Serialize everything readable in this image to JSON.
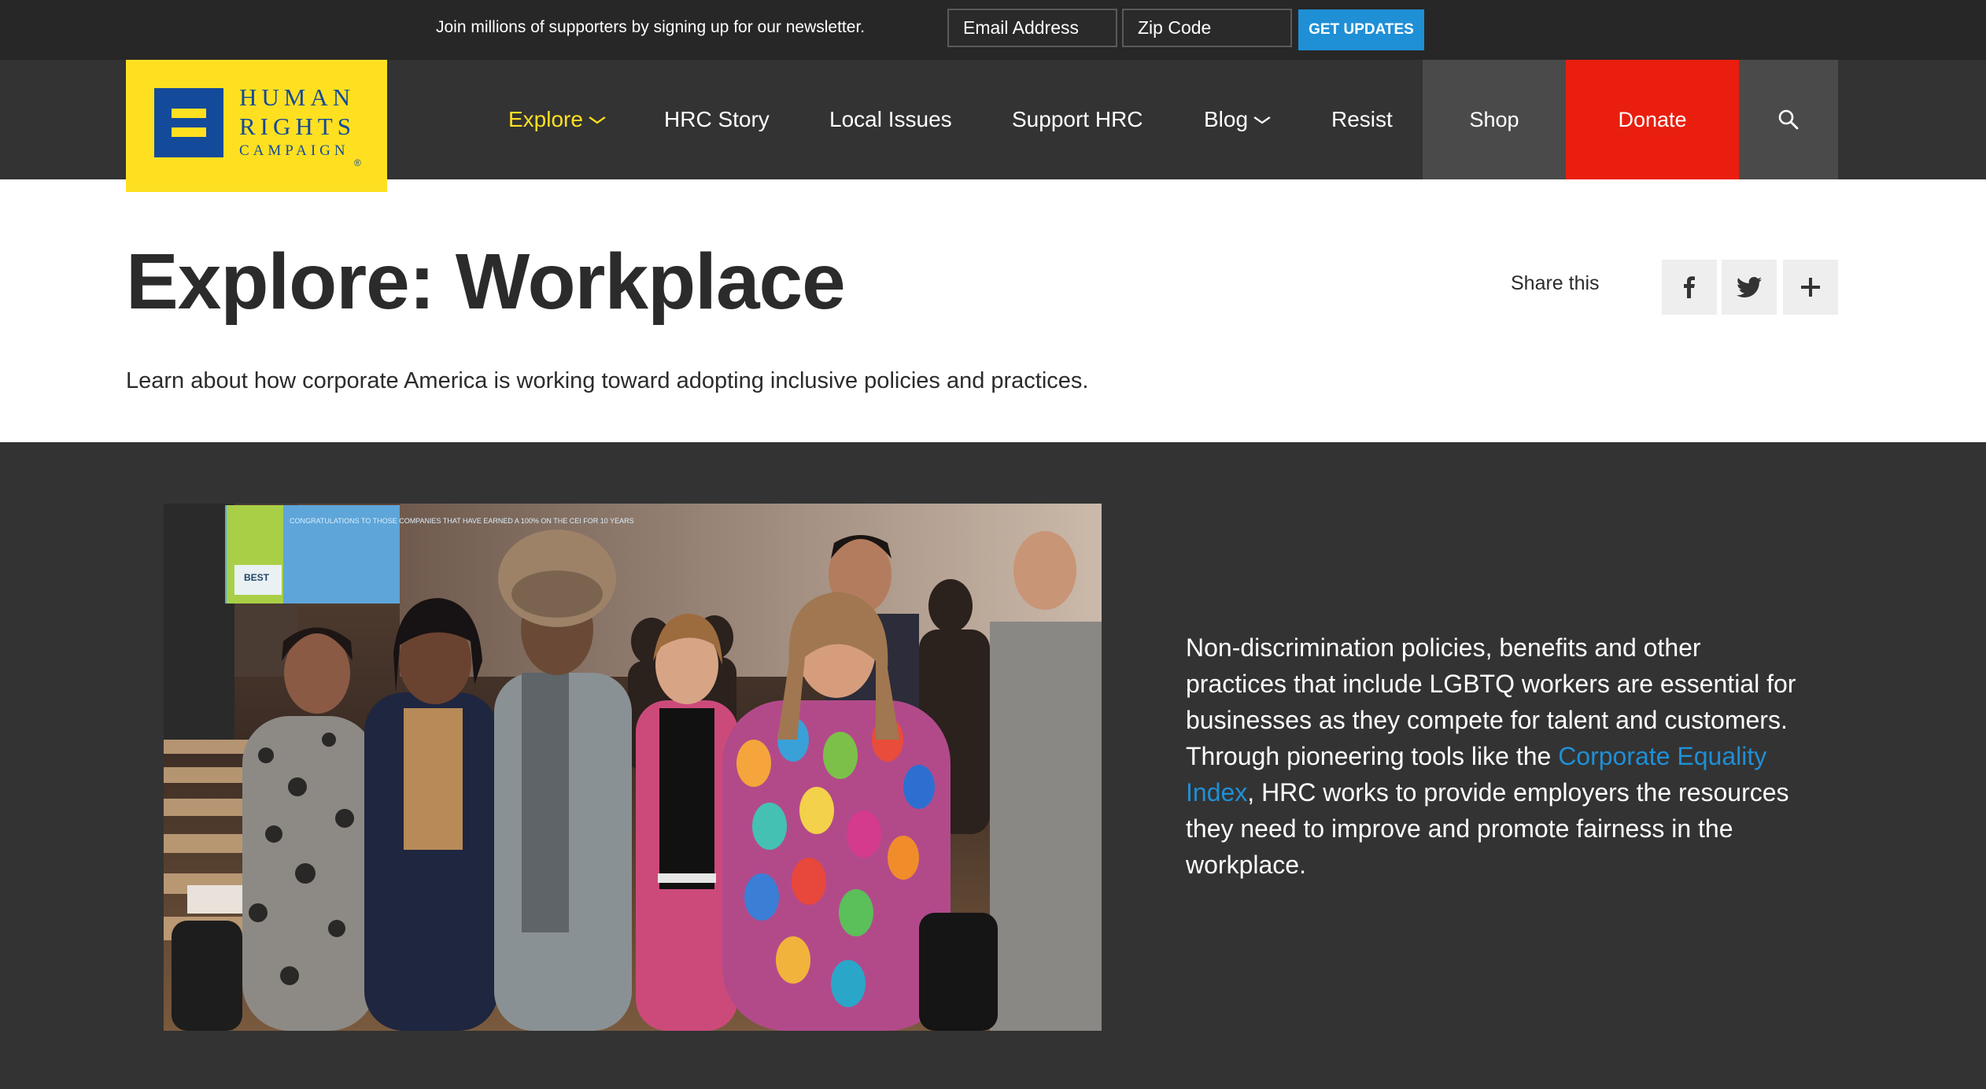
{
  "newsletter": {
    "message": "Join millions of supporters by signing up for our newsletter.",
    "email_placeholder": "Email Address",
    "zip_placeholder": "Zip Code",
    "submit_label": "GET UPDATES"
  },
  "logo": {
    "line1": "HUMAN",
    "line2": "RIGHTS",
    "line3": "CAMPAIGN",
    "registered": "®"
  },
  "nav": {
    "items": [
      {
        "label": "Explore",
        "active": true,
        "has_dropdown": true
      },
      {
        "label": "HRC Story",
        "active": false,
        "has_dropdown": false
      },
      {
        "label": "Local Issues",
        "active": false,
        "has_dropdown": false
      },
      {
        "label": "Support HRC",
        "active": false,
        "has_dropdown": false
      },
      {
        "label": "Blog",
        "active": false,
        "has_dropdown": true
      },
      {
        "label": "Resist",
        "active": false,
        "has_dropdown": false
      }
    ],
    "shop_label": "Shop",
    "donate_label": "Donate",
    "search_icon": "search-icon"
  },
  "page": {
    "title": "Explore: Workplace",
    "lede": "Learn about how corporate America is working toward adopting inclusive policies and practices.",
    "share_label": "Share this",
    "share_icons": [
      "facebook-icon",
      "twitter-icon",
      "plus-icon"
    ]
  },
  "feature": {
    "text_before": "Non-discrimination policies, benefits and other practices that include LGBTQ workers are essential for businesses as they compete for talent and customers. Through pioneering tools like the ",
    "link_text": "Corporate Equality Index",
    "text_after": ", HRC works to provide employers the resources they need to improve and promote fairness in the workplace.",
    "photo_screen_text": "CONGRATULATIONS TO THOSE COMPANIES THAT HAVE EARNED A 100% ON THE CEI FOR 10 YEARS",
    "photo_screen_badge": "BEST"
  },
  "colors": {
    "brand_yellow": "#ffe021",
    "brand_blue": "#144a9a",
    "donate_red": "#ea1e0e",
    "link_blue": "#1f8fd6",
    "dark_bg": "#333333"
  }
}
